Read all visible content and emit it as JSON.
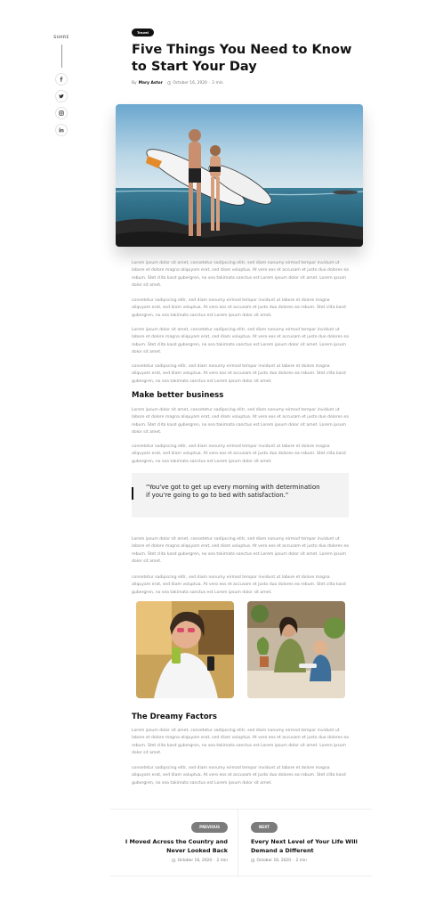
{
  "share": {
    "label": "SHARE",
    "icons": [
      "facebook-icon",
      "twitter-icon",
      "instagram-icon",
      "linkedin-icon"
    ]
  },
  "post": {
    "tag": "Travel",
    "title": "Five Things You Need to Know to Start Your Day",
    "by_prefix": "By",
    "author": "Mary Astor",
    "date": "October 16, 2020",
    "read_time": "2 min",
    "separator": "·"
  },
  "body": {
    "p1": "Lorem ipsum dolor sit amet, consetetur sadipscing elitr, sed diam nonumy eirmod tempor invidunt ut labore et dolore magna aliquyam erat, sed diam voluptua. At vero eos et accusam et justo duo dolores ea rebum. Stet clita kasd gubergren, no sea takimata sanctus est Lorem ipsum dolor sit amet. Lorem ipsum dolor sit amet.",
    "p2": "consetetur sadipscing elitr, sed diam nonumy eirmod tempor invidunt ut labore et dolore magna aliquyam erat, sed diam voluptua. At vero eos et accusam et justo duo dolores ea rebum. Stet clita kasd gubergren, no sea takimata sanctus est Lorem ipsum dolor sit amet.",
    "p3": "Lorem ipsum dolor sit amet, consetetur sadipscing elitr, sed diam nonumy eirmod tempor invidunt ut labore et dolore magna aliquyam erat, sed diam voluptua. At vero eos et accusam et justo duo dolores ea rebum. Stet clita kasd gubergren, no sea takimata sanctus est Lorem ipsum dolor sit amet. Lorem ipsum dolor sit amet.",
    "p4": "consetetur sadipscing elitr, sed diam nonumy eirmod tempor invidunt ut labore et dolore magna aliquyam erat, sed diam voluptua. At vero eos et accusam et justo duo dolores ea rebum. Stet clita kasd gubergren, no sea takimata sanctus est Lorem ipsum dolor sit amet.",
    "h_business": "Make better business",
    "p5": "Lorem ipsum dolor sit amet, consetetur sadipscing elitr, sed diam nonumy eirmod tempor invidunt ut labore et dolore magna aliquyam erat, sed diam voluptua. At vero eos et accusam et justo duo dolores ea rebum. Stet clita kasd gubergren, no sea takimata sanctus est Lorem ipsum dolor sit amet. Lorem ipsum dolor sit amet.",
    "p6": "consetetur sadipscing elitr, sed diam nonumy eirmod tempor invidunt ut labore et dolore magna aliquyam erat, sed diam voluptua. At vero eos et accusam et justo duo dolores ea rebum. Stet clita kasd gubergren, no sea takimata sanctus est Lorem ipsum dolor sit amet.",
    "quote": "\"You've got to get up every morning with determination if you're going to go to bed with satisfaction.\"",
    "p7": "Lorem ipsum dolor sit amet, consetetur sadipscing elitr, sed diam nonumy eirmod tempor invidunt ut labore et dolore magna aliquyam erat, sed diam voluptua. At vero eos et accusam et justo duo dolores ea rebum. Stet clita kasd gubergren, no sea takimata sanctus est Lorem ipsum dolor sit amet. Lorem ipsum dolor sit amet.",
    "p8": "consetetur sadipscing elitr, sed diam nonumy eirmod tempor invidunt ut labore et dolore magna aliquyam erat, sed diam voluptua. At vero eos et accusam et justo duo dolores ea rebum. Stet clita kasd gubergren, no sea takimata sanctus est Lorem ipsum dolor sit amet.",
    "h_dreamy": "The Dreamy Factors",
    "p9": "Lorem ipsum dolor sit amet, consetetur sadipscing elitr, sed diam nonumy eirmod tempor invidunt ut labore et dolore magna aliquyam erat, sed diam voluptua. At vero eos et accusam et justo duo dolores ea rebum. Stet clita kasd gubergren, no sea takimata sanctus est Lorem ipsum dolor sit amet. Lorem ipsum dolor sit amet.",
    "p10": "consetetur sadipscing elitr, sed diam nonumy eirmod tempor invidunt ut labore et dolore magna aliquyam erat, sed diam voluptua. At vero eos et accusam et justo duo dolores ea rebum. Stet clita kasd gubergren, no sea takimata sanctus est Lorem ipsum dolor sit amet."
  },
  "post_nav": {
    "prev": {
      "label": "PREVIOUS",
      "title": "I Moved Across the Country and Never Looked Back",
      "date": "October 16, 2020",
      "read_time": "2 min"
    },
    "next": {
      "label": "NEXT",
      "title": "Every Next Level of Your Life Will Demand a Different",
      "date": "October 16, 2020",
      "read_time": "2 min"
    }
  },
  "colors": {
    "accent": "#111111",
    "pill": "#7c7c7c",
    "body_text": "#8a8a8a",
    "quote_bg": "#f3f3f3"
  }
}
